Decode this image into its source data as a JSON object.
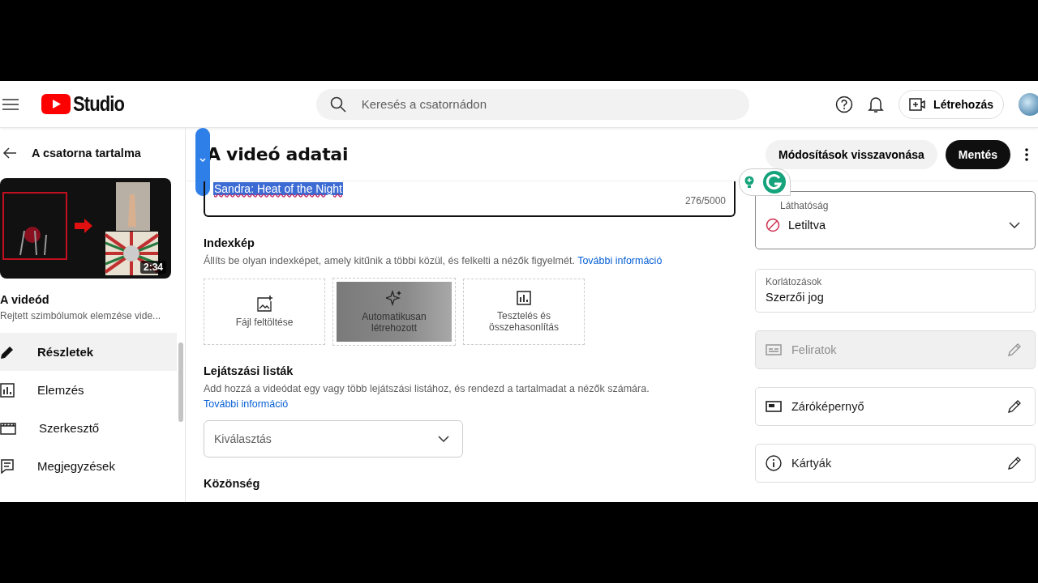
{
  "header": {
    "logo_text": "Studio",
    "search": {
      "placeholder": "Keresés a csatornádon"
    },
    "create_button": "Létrehozás"
  },
  "sidebar": {
    "back_label": "A csatorna tartalma",
    "video_thumbnail": {
      "kind": "picture",
      "duration": "2:34"
    },
    "video_heading": "A videód",
    "video_title": "Rejtett szimbólumok elemzése vide...",
    "items": [
      {
        "label": "Részletek",
        "kind": "pencil",
        "selected": true
      },
      {
        "label": "Elemzés",
        "kind": "chart",
        "selected": false
      },
      {
        "label": "Szerkesztő",
        "kind": "clapper",
        "selected": false
      },
      {
        "label": "Megjegyzések",
        "kind": "comment",
        "selected": false
      }
    ]
  },
  "page": {
    "title": "A videó adatai",
    "undo_button": "Módosítások visszavonása",
    "save_button": "Mentés"
  },
  "description": {
    "value": "Sandra: Heat of the Night",
    "counter": "276/5000"
  },
  "thumbnail_section": {
    "heading": "Indexkép",
    "text": "Állíts be olyan indexképet, amely kitűnik a többi közül, és felkelti a nézők figyelmét.",
    "link": "További információ",
    "options": [
      {
        "kind": "upload",
        "label": "Fájl feltöltése"
      },
      {
        "kind": "auto",
        "label": "Automatikusan létrehozott"
      },
      {
        "kind": "test",
        "label": "Tesztelés és összehasonlítás"
      }
    ]
  },
  "playlists_section": {
    "heading": "Lejátszási listák",
    "text": "Add hozzá a videódat egy vagy több lejátszási listához, és rendezd a tartalmadat a nézők számára.",
    "link": "További információ",
    "select": {
      "placeholder": "Kiválasztás"
    }
  },
  "audience_section": {
    "heading": "Közönség"
  },
  "right_panel": {
    "visibility": {
      "label": "Láthatóság",
      "value": "Letiltva"
    },
    "restrictions": {
      "label": "Korlátozások",
      "value": "Szerzői jog"
    },
    "items": [
      {
        "label": "Feliratok",
        "kind": "subtitles",
        "disabled": true
      },
      {
        "label": "Záróképernyő",
        "kind": "endscreen",
        "disabled": false
      },
      {
        "label": "Kártyák",
        "kind": "info",
        "disabled": false
      }
    ]
  }
}
